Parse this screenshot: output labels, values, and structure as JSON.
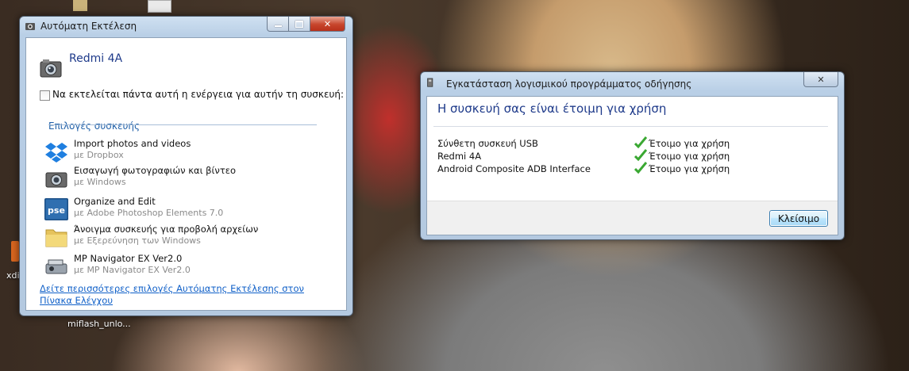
{
  "desktop": {
    "label_left": "xdi",
    "label_bottom": "miflash_unlo..."
  },
  "autoplay": {
    "title": "Αυτόματη Εκτέλεση",
    "device_name": "Redmi 4A",
    "always_do_label": "Να εκτελείται πάντα αυτή η ενέργεια για αυτήν τη συσκευή:",
    "section_title": "Επιλογές συσκευής",
    "options": [
      {
        "title": "Import photos and videos",
        "subtitle": "με Dropbox",
        "icon": "dropbox-icon"
      },
      {
        "title": "Εισαγωγή φωτογραφιών και βίντεο",
        "subtitle": "με Windows",
        "icon": "camera-icon"
      },
      {
        "title": "Organize and Edit",
        "subtitle": "με Adobe Photoshop Elements 7.0",
        "icon": "pse-icon"
      },
      {
        "title": "Άνοιγμα συσκευής για προβολή αρχείων",
        "subtitle": "με Εξερεύνηση των Windows",
        "icon": "folder-icon"
      },
      {
        "title": "MP Navigator EX Ver2.0",
        "subtitle": "με MP Navigator EX Ver2.0",
        "icon": "scanner-icon"
      }
    ],
    "control_panel_link": "Δείτε περισσότερες επιλογές Αυτόματης Εκτέλεσης στον Πίνακα Ελέγχου"
  },
  "driver_install": {
    "title": "Εγκατάσταση λογισμικού προγράμματος οδήγησης",
    "heading": "Η συσκευή σας είναι έτοιμη για χρήση",
    "devices": [
      {
        "name": "Σύνθετη συσκευή USB",
        "status": "Έτοιμο για χρήση"
      },
      {
        "name": "Redmi 4A",
        "status": "Έτοιμο για χρήση"
      },
      {
        "name": "Android Composite ADB Interface",
        "status": "Έτοιμο για χρήση"
      }
    ],
    "close_button": "Κλείσιμο"
  },
  "colors": {
    "accent_text": "#1e3a8a",
    "link": "#1060c8",
    "check_green": "#3aa832"
  }
}
